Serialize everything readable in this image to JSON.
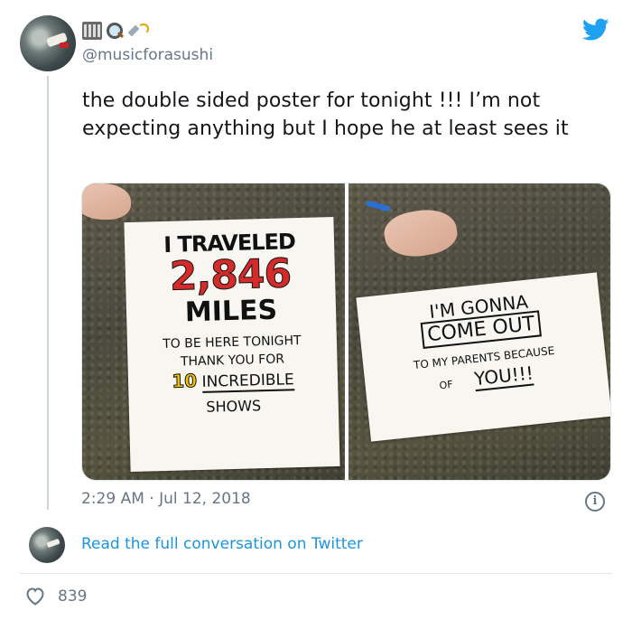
{
  "tweet": {
    "handle": "@musicforasushi",
    "display_name_emojis": [
      "film-frames-emoji",
      "magnifying-glass-emoji",
      "satellite-emoji"
    ],
    "text": "the double sided poster for tonight !!! I’m not expecting anything but I hope he at least sees it",
    "timestamp": "2:29 AM · Jul 12, 2018",
    "likes": "839",
    "read_link": "Read the full conversation on Twitter"
  },
  "photos": {
    "left": {
      "lines": [
        "I TRAVELED",
        "2,846",
        "MILES",
        "TO BE HERE TONIGHT",
        "THANK YOU FOR",
        "10",
        "INCREDIBLE",
        "SHOWS"
      ]
    },
    "right": {
      "lines": [
        "I'M GONNA",
        "COME OUT",
        "TO MY PARENTS BECAUSE",
        "OF",
        "YOU!!!"
      ]
    }
  },
  "colors": {
    "brand_blue": "#1da1f2",
    "link_blue": "#1b95e0",
    "muted_text": "#657786",
    "poster_red": "#d42a2a",
    "poster_yellow": "#f2c300"
  }
}
